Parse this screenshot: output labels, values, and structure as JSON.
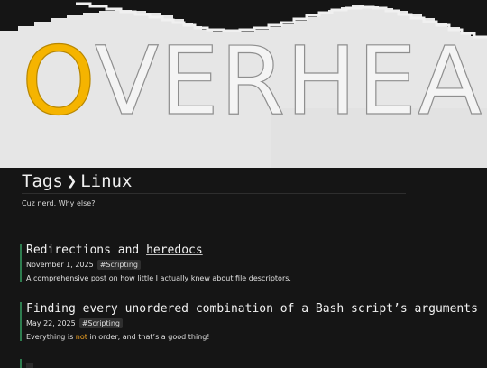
{
  "banner": {
    "logo_accent": "O",
    "logo_rest": "VERHEAD",
    "colors": {
      "accent": "#f5b400",
      "dark": "#151515",
      "light": "#e6e6e6"
    }
  },
  "breadcrumb": {
    "root": "Tags",
    "separator": "❯",
    "current": "Linux"
  },
  "tag_description": "Cuz nerd. Why else?",
  "posts": [
    {
      "title_plain": "Redirections and ",
      "title_underlined": "heredocs",
      "date": "November 1, 2025",
      "tag": "#Scripting",
      "summary": "A comprehensive post on how little I actually knew about file descriptors."
    },
    {
      "title_plain": "Finding every unordered combination of a Bash script’s arguments",
      "date": "May 22, 2025",
      "tag": "#Scripting",
      "summary_before": "Everything is ",
      "summary_highlight": "not",
      "summary_after": " in order, and that’s a good thing!"
    }
  ],
  "accent_colors": {
    "post_border": "#2e7d4f",
    "highlight": "#f5a623"
  }
}
